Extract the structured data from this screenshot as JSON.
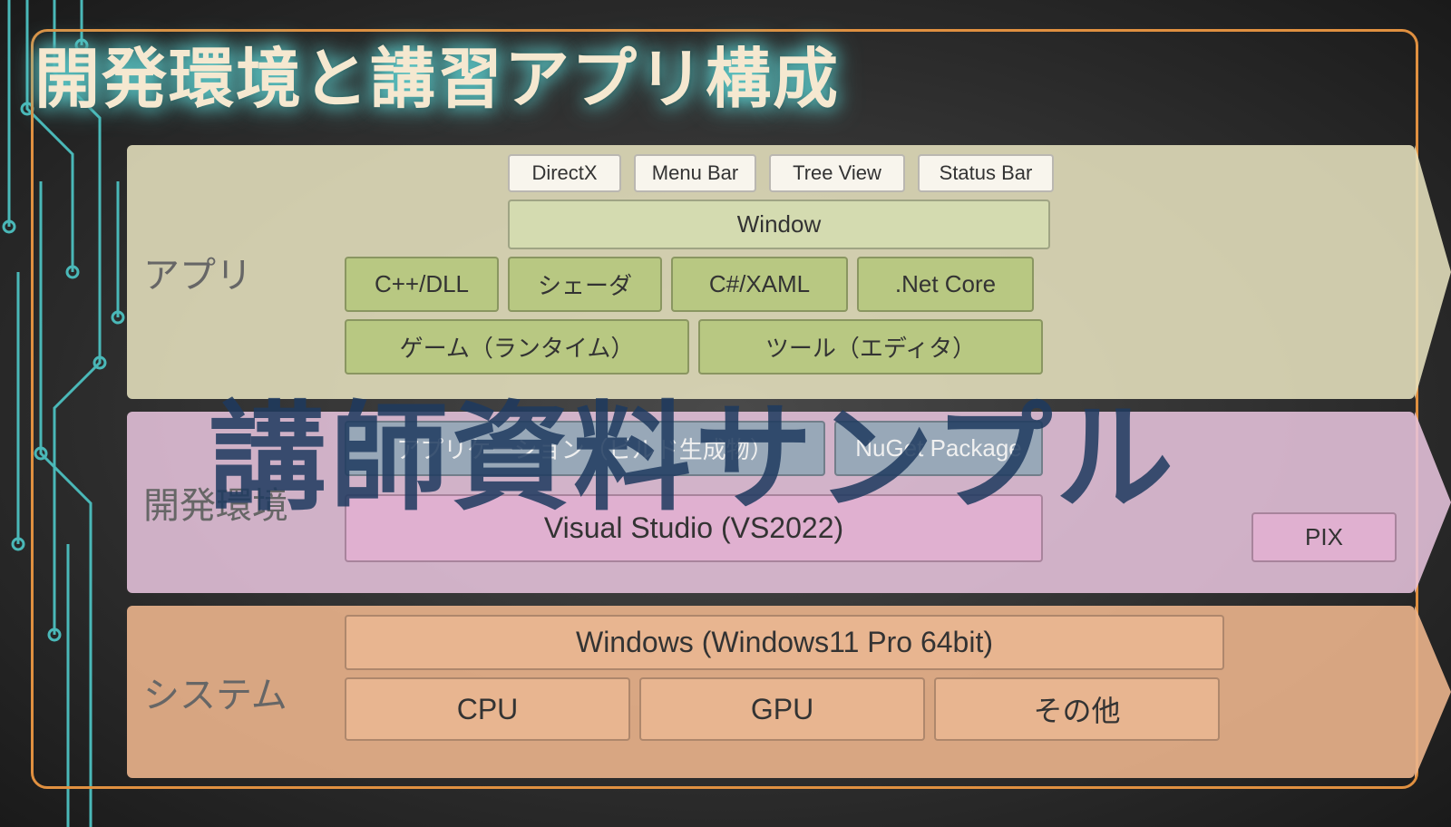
{
  "title": "開発環境と講習アプリ構成",
  "watermark": "講師資料サンプル",
  "layers": {
    "app": {
      "label": "アプリ",
      "row1": [
        "DirectX",
        "Menu Bar",
        "Tree View",
        "Status Bar"
      ],
      "window": "Window",
      "row3": [
        "C++/DLL",
        "シェーダ",
        "C#/XAML",
        ".Net Core"
      ],
      "row4": [
        "ゲーム（ランタイム）",
        "ツール（エディタ）"
      ]
    },
    "dev": {
      "label": "開発環境",
      "row1": [
        "アプリケーション（ビルド生成物）",
        "NuGet Package"
      ],
      "row2_main": "Visual Studio (VS2022)",
      "row2_side": "PIX"
    },
    "sys": {
      "label": "システム",
      "os": "Windows (Windows11 Pro 64bit)",
      "hw": [
        "CPU",
        "GPU",
        "その他"
      ]
    }
  }
}
